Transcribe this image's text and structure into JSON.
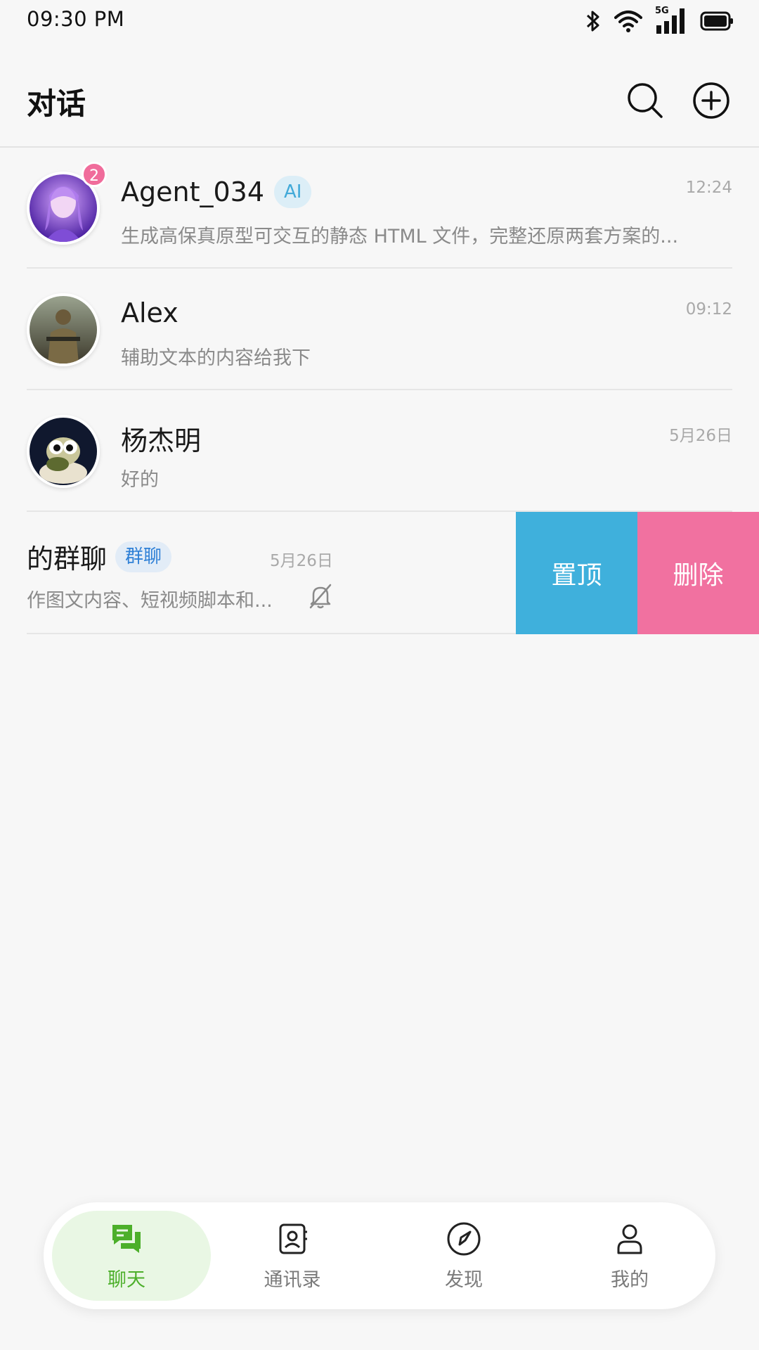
{
  "status_bar": {
    "time": "09:30 PM",
    "network": "5G",
    "icons": [
      "bluetooth-icon",
      "wifi-icon",
      "signal-5g-icon",
      "battery-icon"
    ]
  },
  "header": {
    "title": "对话",
    "search_icon": "search-icon",
    "add_icon": "plus-circle-icon"
  },
  "chats": [
    {
      "name": "Agent_034",
      "tag": "AI",
      "time": "12:24",
      "preview": "生成高保真原型可交互的静态 HTML 文件，完整还原两套方案的...",
      "unread": "2"
    },
    {
      "name": "Alex",
      "time": "09:12",
      "preview": "辅助文本的内容给我下"
    },
    {
      "name": "杨杰明",
      "time": "5月26日",
      "preview": "好的"
    }
  ],
  "swiped_chat": {
    "name": "的群聊",
    "tag": "群聊",
    "time": "5月26日",
    "preview": "作图文内容、短视频脚本和...",
    "muted_icon": "bell-off-icon",
    "actions": {
      "pin": "置顶",
      "delete": "删除"
    }
  },
  "bottom_nav": [
    {
      "label": "聊天",
      "icon": "chat-icon",
      "active": true
    },
    {
      "label": "通讯录",
      "icon": "contacts-icon",
      "active": false
    },
    {
      "label": "发现",
      "icon": "compass-icon",
      "active": false
    },
    {
      "label": "我的",
      "icon": "user-icon",
      "active": false
    }
  ],
  "colors": {
    "accent_green": "#4caf2a",
    "badge_pink": "#f06c9b",
    "pin_blue": "#3fb0dc",
    "delete_pink": "#f171a0"
  }
}
